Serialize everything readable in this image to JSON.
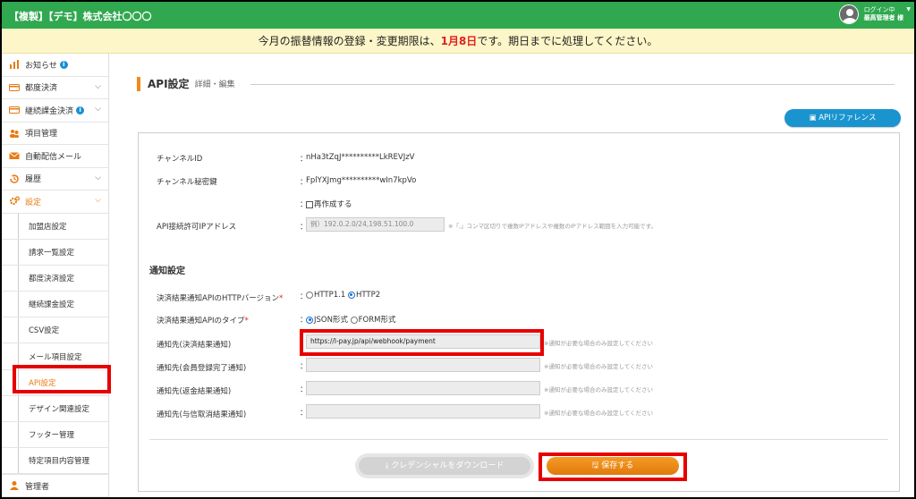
{
  "header": {
    "title": "【複製】【デモ】株式会社〇〇〇",
    "user_status": "ログイン中",
    "user_name": "最高管理者 様"
  },
  "notice": {
    "before": "今月の振替情報の登録・変更期限は、",
    "deadline": "1月8日",
    "after": "です。期日までに処理してください。"
  },
  "sidebar": {
    "items": [
      {
        "label": "お知らせ",
        "icon": "bar-chart-icon"
      },
      {
        "label": "都度決済",
        "icon": "card-icon"
      },
      {
        "label": "継続課金決済",
        "icon": "card-icon"
      },
      {
        "label": "項目管理",
        "icon": "users-icon"
      },
      {
        "label": "自動配信メール",
        "icon": "mail-icon"
      },
      {
        "label": "履歴",
        "icon": "history-icon"
      },
      {
        "label": "設定",
        "icon": "gear-icon"
      }
    ],
    "sub_items": [
      "加盟店設定",
      "請求一覧設定",
      "都度決済設定",
      "継続課金設定",
      "CSV設定",
      "メール項目設定",
      "API設定",
      "デザイン関連設定",
      "フッター管理",
      "特定項目内容管理"
    ],
    "bottom_item": "管理者"
  },
  "page": {
    "title": "API設定",
    "subtitle": "詳細・編集",
    "reference_button": "APIリファレンス"
  },
  "form": {
    "channel_id_label": "チャンネルID",
    "channel_id_value": "nHa3tZqJ**********LkREVJzV",
    "channel_secret_label": "チャンネル秘密鍵",
    "channel_secret_value": "FplYXJmg**********wIn7kpVo",
    "regenerate_label": "再作成する",
    "ip_label": "API接続許可IPアドレス",
    "ip_placeholder": "例）192.0.2.0/24,198.51.100.0",
    "ip_hint": "※「,」コンマ区切りで複数IPアドレスや複数のIPアドレス範囲を入力可能です。",
    "notify_section": "通知設定",
    "http_version_label": "決済結果通知APIのHTTPバージョン",
    "http_options": [
      "HTTP1.1",
      "HTTP2"
    ],
    "http_selected": "HTTP2",
    "type_label": "決済結果通知APIのタイプ",
    "type_options": [
      "JSON形式",
      "FORM形式"
    ],
    "type_selected": "JSON形式",
    "url1_label": "通知先(決済結果通知)",
    "url1_value": "https://l-pay.jp/api/webhook/payment",
    "url2_label": "通知先(会員登録完了通知)",
    "url3_label": "通知先(返金結果通知)",
    "url4_label": "通知先(与信取消結果通知)",
    "url_hint": "※通知が必要な場合のみ設定してください",
    "download_button": "クレデンシャルをダウンロード",
    "save_button": "保存する",
    "colon": "："
  },
  "colors": {
    "header_green": "#2fa84f",
    "notice_bg": "#fdf6c8",
    "accent_orange": "#f08a1c",
    "highlight_red": "#e60000",
    "button_blue": "#1a94cf"
  }
}
